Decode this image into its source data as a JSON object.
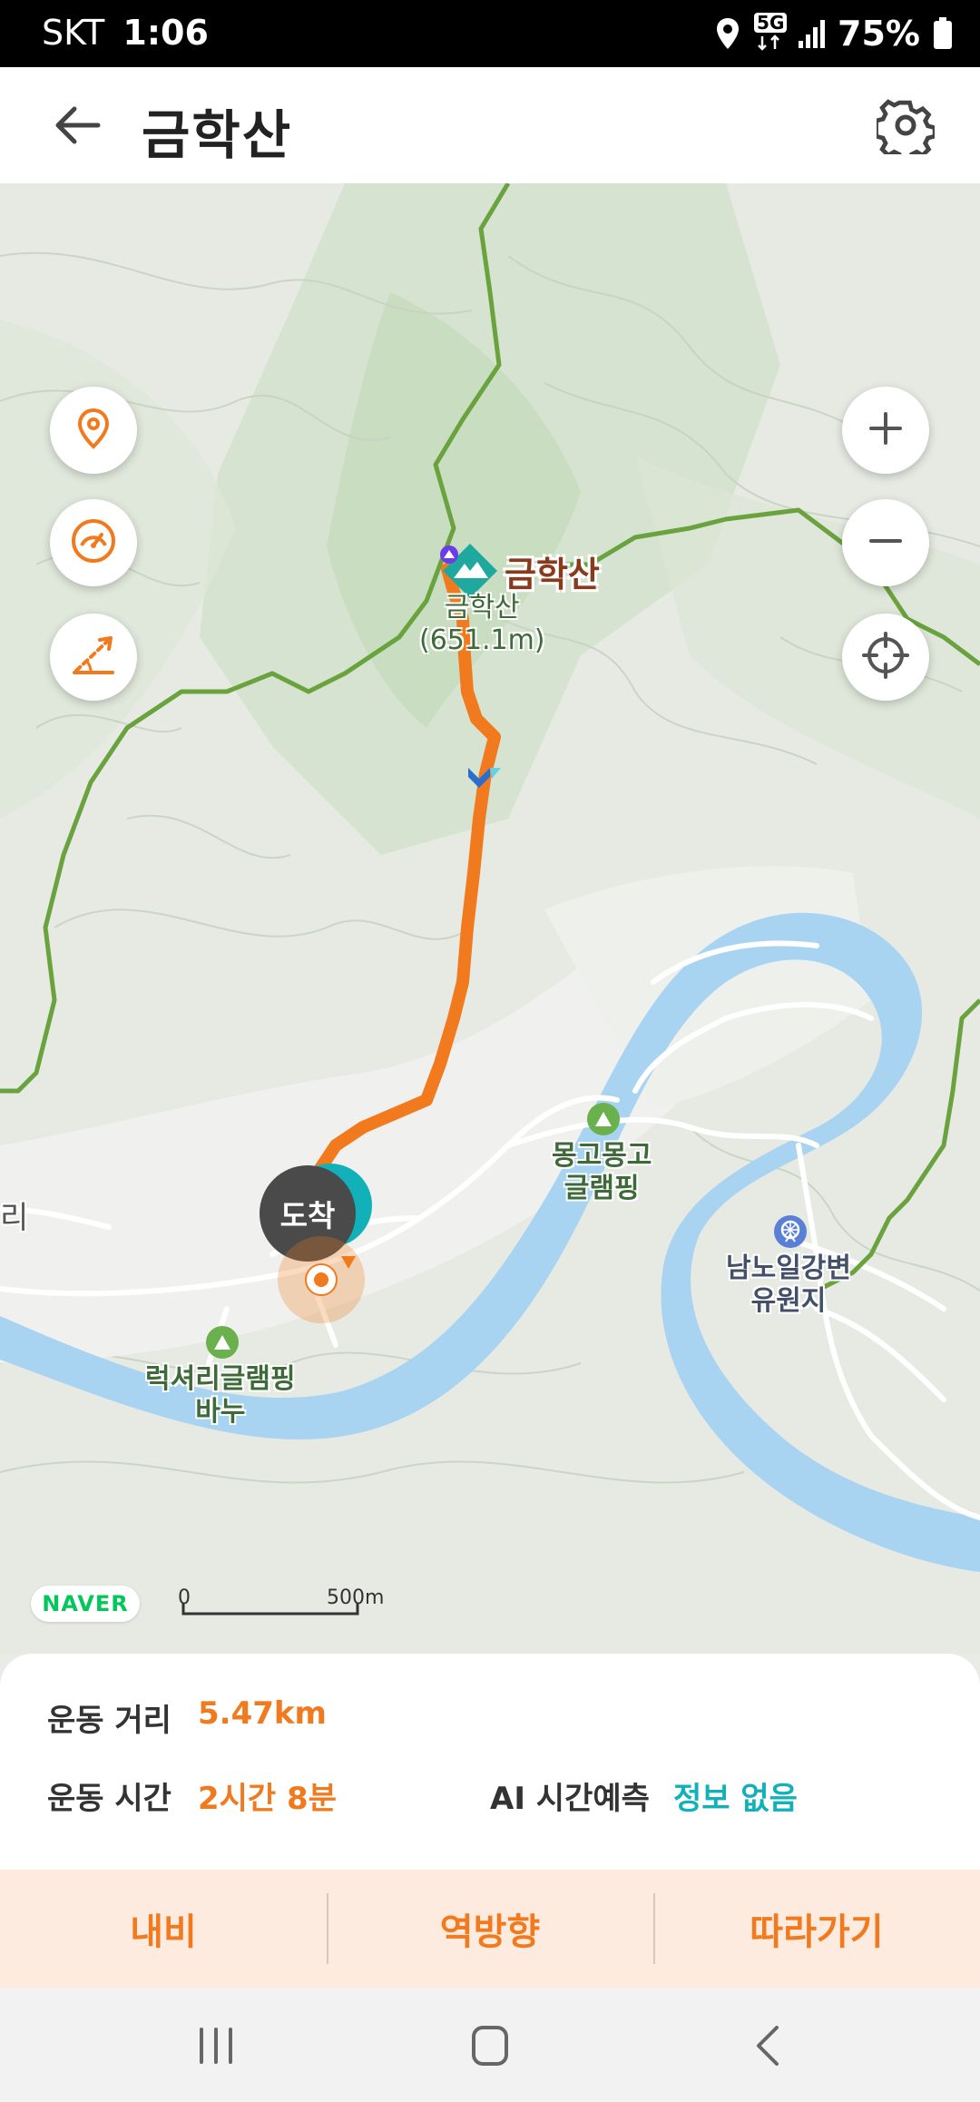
{
  "status_bar": {
    "carrier": "SKT",
    "time": "1:06",
    "network": "5G",
    "battery": "75%",
    "icons": [
      "location-icon",
      "5g-icon",
      "signal-icon",
      "battery-icon"
    ]
  },
  "header": {
    "title": "금학산",
    "icons": [
      "back-arrow-icon",
      "gear-icon"
    ]
  },
  "map": {
    "controls_left": [
      "location-pin-icon",
      "speedometer-icon",
      "elevation-slope-icon"
    ],
    "controls_right": [
      "zoom-in-icon",
      "zoom-out-icon",
      "crosshair-icon"
    ],
    "peak": {
      "name": "금학산",
      "sublabel": "금학산",
      "elevation": "(651.1m)"
    },
    "arrival_marker": "도착",
    "labels": {
      "campsite_1_line1": "몽고몽고",
      "campsite_1_line2": "글램핑",
      "resort_line1": "남노일강변",
      "resort_line2": "유원지",
      "campsite_2_line1": "럭셔리글램핑",
      "campsite_2_line2": "바누",
      "edge_partial": "리"
    },
    "brand": "NAVER",
    "scale": {
      "start": "0",
      "end": "500m"
    },
    "colors": {
      "route": "#f27a1e",
      "river": "#a8d4f2",
      "trail": "#6aa23e",
      "marker_teal": "#12b0b8"
    }
  },
  "stats": {
    "distance_label": "운동 거리",
    "distance_value": "5.47km",
    "time_label": "운동 시간",
    "time_value": "2시간 8분",
    "ai_label": "AI 시간예측",
    "ai_value": "정보 없음"
  },
  "actions": {
    "navi": "내비",
    "reverse": "역방향",
    "follow": "따라가기"
  },
  "nav_bar": [
    "recent-apps-icon",
    "home-icon",
    "back-icon"
  ]
}
